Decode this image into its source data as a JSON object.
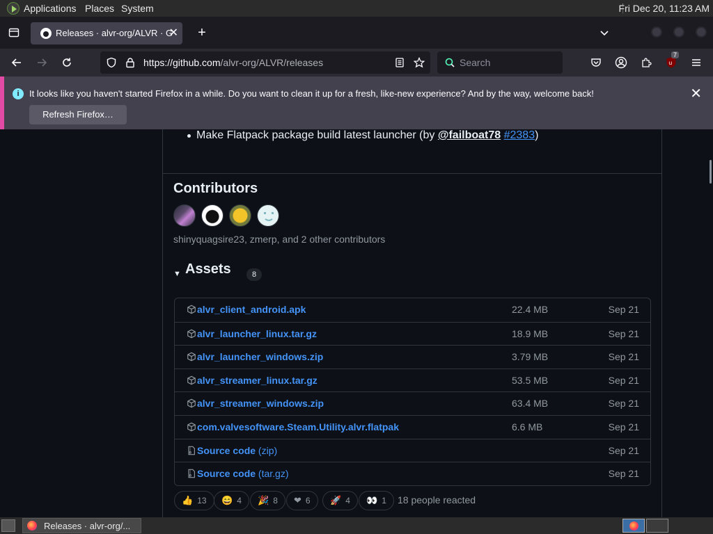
{
  "panel": {
    "menus": [
      "Applications",
      "Places",
      "System"
    ],
    "clock": "Fri Dec 20, 11:23 AM"
  },
  "browser": {
    "tab_title": "Releases · alvr-org/ALVR · G",
    "url_host": "https://github.com",
    "url_path": "/alvr-org/ALVR/releases",
    "search_placeholder": "Search",
    "extension_badge": "7"
  },
  "notification": {
    "message": "It looks like you haven't started Firefox in a while. Do you want to clean it up for a fresh, like-new experience? And by the way, welcome back!",
    "button_label": "Refresh Firefox…",
    "accent": "#e24aa5"
  },
  "release": {
    "bullet_prefix": "Make Flatpack package build latest launcher (by ",
    "bullet_mention": "@failboat78",
    "bullet_link": "#2383",
    "bullet_suffix": ")",
    "contributors_title": "Contributors",
    "contributors_text": "shinyquagsire23, zmerp, and 2 other contributors",
    "assets_title": "Assets",
    "assets_count": "8",
    "assets": [
      {
        "name": "alvr_client_android.apk",
        "ext": "",
        "size": "22.4 MB",
        "date": "Sep 21",
        "icon": "package-icon"
      },
      {
        "name": "alvr_launcher_linux.tar.gz",
        "ext": "",
        "size": "18.9 MB",
        "date": "Sep 21",
        "icon": "package-icon"
      },
      {
        "name": "alvr_launcher_windows.zip",
        "ext": "",
        "size": "3.79 MB",
        "date": "Sep 21",
        "icon": "package-icon"
      },
      {
        "name": "alvr_streamer_linux.tar.gz",
        "ext": "",
        "size": "53.5 MB",
        "date": "Sep 21",
        "icon": "package-icon"
      },
      {
        "name": "alvr_streamer_windows.zip",
        "ext": "",
        "size": "63.4 MB",
        "date": "Sep 21",
        "icon": "package-icon"
      },
      {
        "name": "com.valvesoftware.Steam.Utility.alvr.flatpak",
        "ext": "",
        "size": "6.6 MB",
        "date": "Sep 21",
        "icon": "package-icon"
      },
      {
        "name": "Source code",
        "ext": "(zip)",
        "size": "",
        "date": "Sep 21",
        "icon": "file-zip-icon"
      },
      {
        "name": "Source code",
        "ext": "(tar.gz)",
        "size": "",
        "date": "Sep 21",
        "icon": "file-zip-icon"
      }
    ],
    "reactions": [
      {
        "emoji": "👍",
        "count": "13"
      },
      {
        "emoji": "😄",
        "count": "4"
      },
      {
        "emoji": "🎉",
        "count": "8"
      },
      {
        "emoji": "❤",
        "count": "6"
      },
      {
        "emoji": "🚀",
        "count": "4"
      },
      {
        "emoji": "👀",
        "count": "1"
      }
    ],
    "reactions_text": "18 people reacted"
  },
  "taskbar": {
    "task_label": "Releases · alvr-org/..."
  }
}
